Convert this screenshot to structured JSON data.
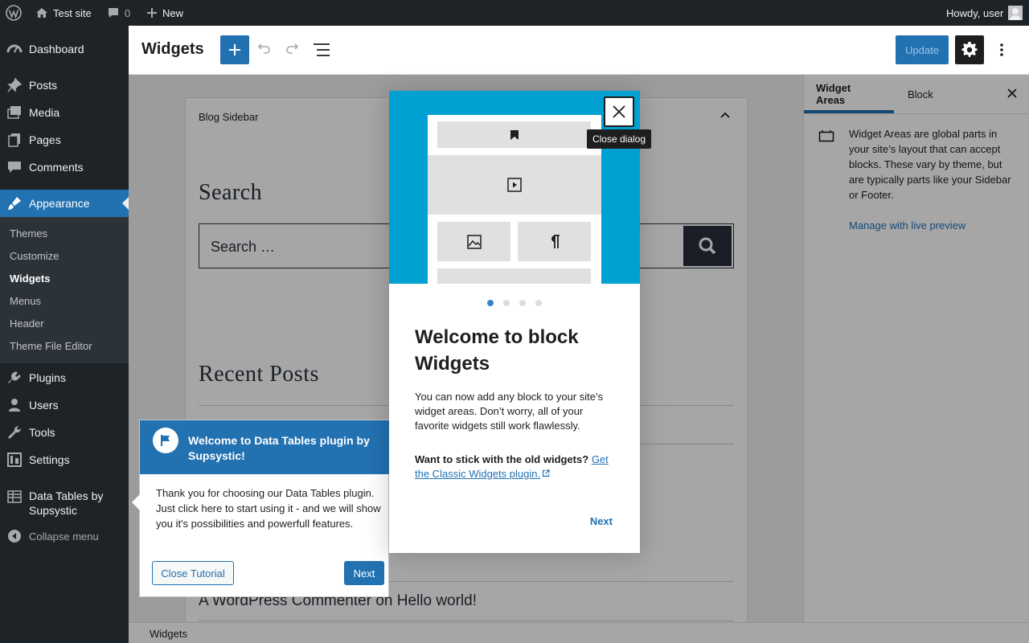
{
  "adminbar": {
    "site_name": "Test site",
    "comments_count": "0",
    "new_label": "New",
    "howdy": "Howdy, user"
  },
  "menu": {
    "items": [
      {
        "label": "Dashboard",
        "icon": "dashboard-icon"
      },
      {
        "label": "Posts",
        "icon": "pin-icon"
      },
      {
        "label": "Media",
        "icon": "media-icon"
      },
      {
        "label": "Pages",
        "icon": "pages-icon"
      },
      {
        "label": "Comments",
        "icon": "comments-icon"
      },
      {
        "label": "Appearance",
        "icon": "brush-icon"
      },
      {
        "label": "Plugins",
        "icon": "plugin-icon"
      },
      {
        "label": "Users",
        "icon": "users-icon"
      },
      {
        "label": "Tools",
        "icon": "wrench-icon"
      },
      {
        "label": "Settings",
        "icon": "settings-icon"
      },
      {
        "label": "Data Tables by Supsystic",
        "icon": "table-icon"
      },
      {
        "label": "Collapse menu",
        "icon": "collapse-icon"
      }
    ],
    "submenu": [
      "Themes",
      "Customize",
      "Widgets",
      "Menus",
      "Header",
      "Theme File Editor"
    ],
    "current_submenu": "Widgets"
  },
  "header": {
    "title": "Widgets",
    "update_label": "Update"
  },
  "canvas": {
    "area_title": "Blog Sidebar",
    "search_heading": "Search",
    "search_placeholder": "Search …",
    "recent_heading": "Recent Posts",
    "comment_item": "A WordPress Commenter on Hello world!"
  },
  "settings": {
    "tabs": [
      "Widget Areas",
      "Block"
    ],
    "description": "Widget Areas are global parts in your site’s layout that can accept blocks. These vary by theme, but are typically parts like your Sidebar or Footer.",
    "link": "Manage with live preview"
  },
  "footer": {
    "breadcrumb": "Widgets"
  },
  "guide": {
    "close_tooltip": "Close dialog",
    "title": "Welcome to block Widgets",
    "text": "You can now add any block to your site’s widget areas. Don’t worry, all of your favorite widgets still work flawlessly.",
    "old_prefix": "Want to stick with the old widgets?",
    "old_link": "Get the Classic Widgets plugin.",
    "next_label": "Next",
    "page_count": 4,
    "current_page": 1
  },
  "pointer": {
    "title": "Welcome to Data Tables plugin by Supsystic!",
    "body": "Thank you for choosing our Data Tables plugin. Just click here to start using it - and we will show you it's possibilities and powerfull features.",
    "close_label": "Close Tutorial",
    "next_label": "Next"
  },
  "colors": {
    "admin_bg": "#1d2327",
    "accent": "#2271b1",
    "hero": "#00a0d2"
  }
}
